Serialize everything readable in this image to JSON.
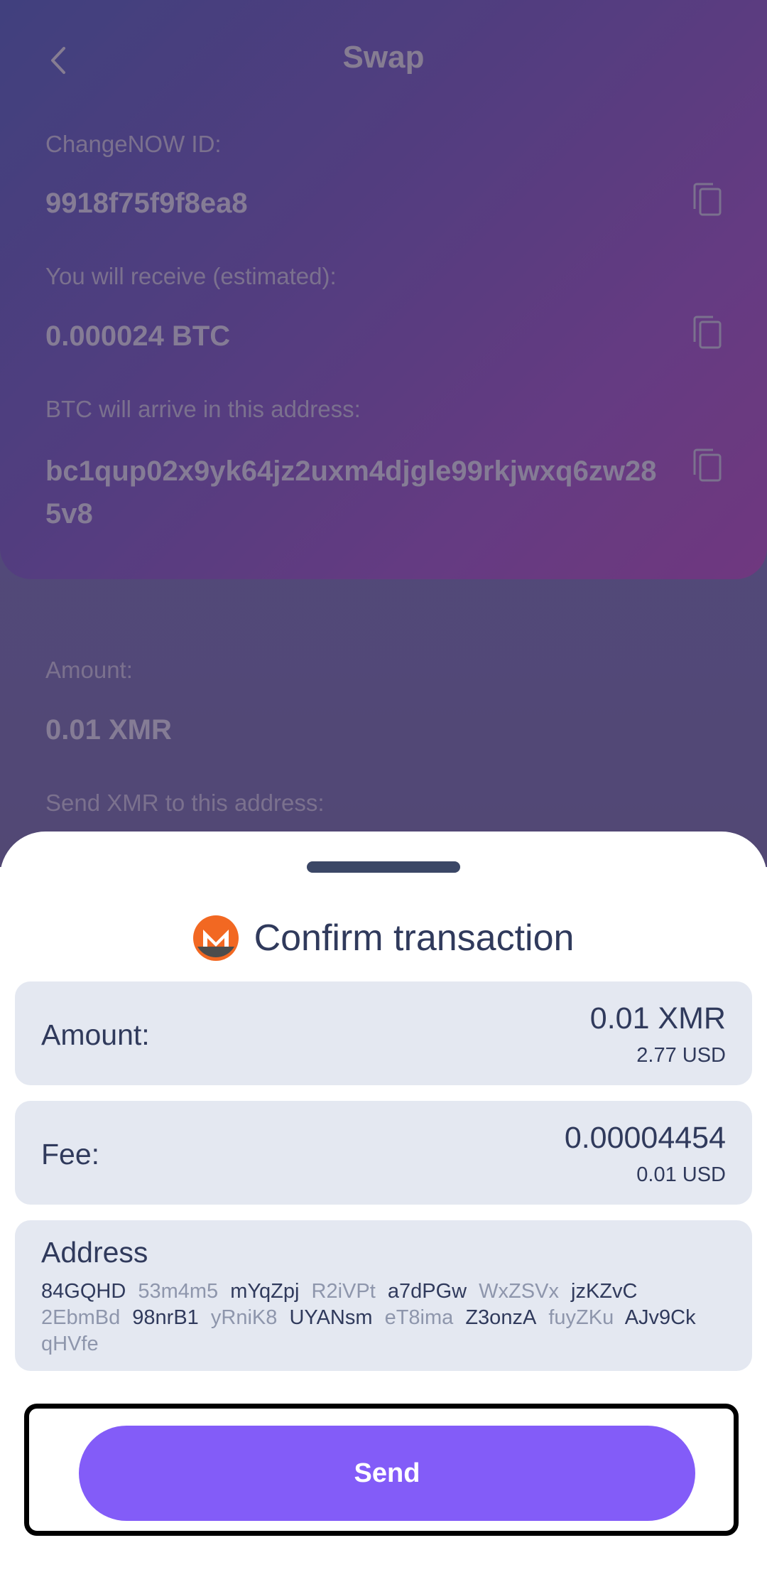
{
  "header": {
    "title": "Swap"
  },
  "swap_details": {
    "id_label": "ChangeNOW ID:",
    "id_value": "9918f75f9f8ea8",
    "receive_label": "You will receive (estimated):",
    "receive_value": "0.000024 BTC",
    "arrive_label": "BTC will arrive in this address:",
    "arrive_value": "bc1qup02x9yk64jz2uxm4djgle99rkjwxq6zw285v8",
    "amount_label": "Amount:",
    "amount_value": "0.01 XMR",
    "send_to_label": "Send XMR to this address:"
  },
  "sheet": {
    "title": "Confirm transaction",
    "amount": {
      "label": "Amount:",
      "value": "0.01 XMR",
      "fiat": "2.77 USD"
    },
    "fee": {
      "label": "Fee:",
      "value": "0.00004454",
      "fiat": "0.01 USD"
    },
    "address": {
      "label": "Address",
      "chunks": [
        "84GQHD",
        "53m4m5",
        "mYqZpj",
        "R2iVPt",
        "a7dPGw",
        "WxZSVx",
        "jzKZvC",
        "2EbmBd",
        "98nrB1",
        "yRniK8",
        "UYANsm",
        "eT8ima",
        "Z3onzA",
        "fuyZKu",
        "AJv9Ck",
        "qHVfe"
      ]
    },
    "send_label": "Send"
  },
  "colors": {
    "accent": "#835cf8",
    "text_dark": "#303a5c",
    "card_bg": "#e4e8f1",
    "monero_orange": "#f26822"
  }
}
